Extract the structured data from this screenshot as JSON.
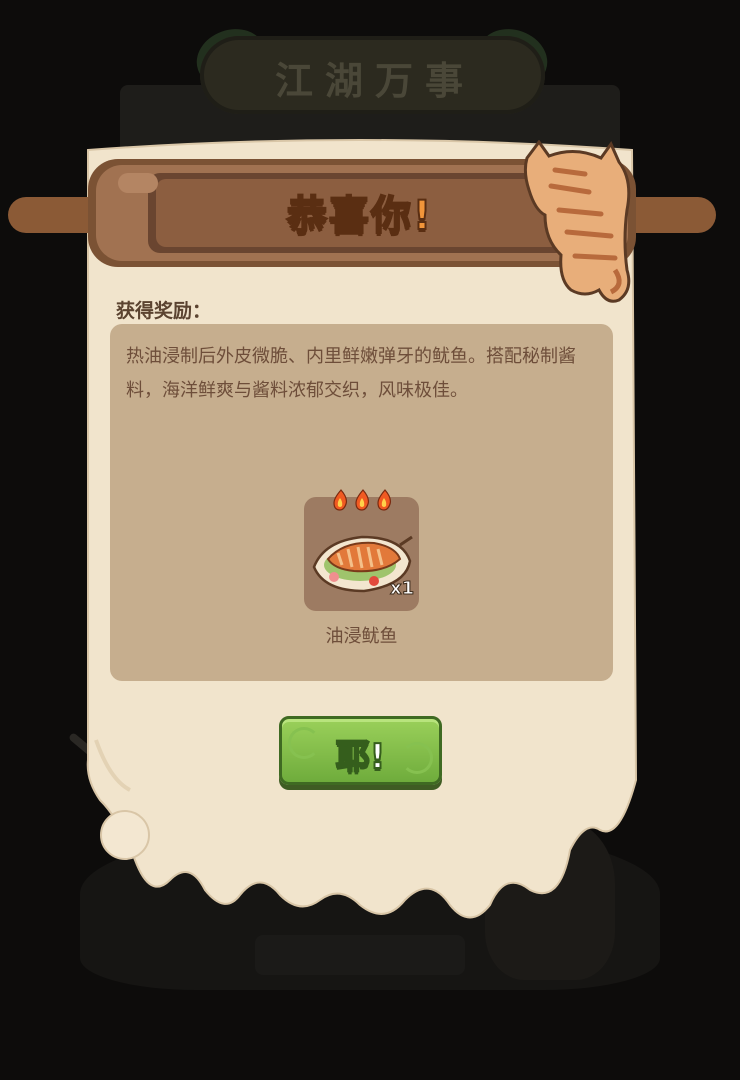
{
  "background": {
    "title": "江湖万事"
  },
  "dialog": {
    "title": "恭喜你!",
    "reward_heading": "获得奖励：",
    "description": "热油浸制后外皮微脆、内里鲜嫩弹牙的鱿鱼。搭配秘制酱料，海洋鲜爽与酱料浓郁交织，风味极佳。",
    "reward_item": {
      "name": "油浸鱿鱼",
      "quantity": "x1",
      "icon": "squid-dish-icon",
      "fire_rating": 3
    },
    "confirm_label": "耶!"
  },
  "colors": {
    "title_orange": "#f1953a",
    "button_green": "#7dbb45",
    "paper": "#f1e4cc",
    "content_box": "#c6ae8e"
  }
}
